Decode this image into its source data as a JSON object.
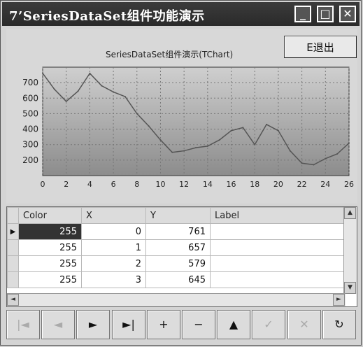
{
  "window": {
    "title": "7’SeriesDataSet组件功能演示",
    "minimize_icon": "minimize-icon",
    "maximize_icon": "maximize-icon",
    "close_icon": "close-icon"
  },
  "exit_button": {
    "label": "E退出"
  },
  "chart_data": {
    "type": "line",
    "title": "SeriesDataSet组件演示(TChart)",
    "x": [
      0,
      1,
      2,
      3,
      4,
      5,
      6,
      7,
      8,
      9,
      10,
      11,
      12,
      13,
      14,
      15,
      16,
      17,
      18,
      19,
      20,
      21,
      22,
      23,
      24,
      25,
      26
    ],
    "values": [
      761,
      657,
      579,
      645,
      760,
      680,
      640,
      610,
      500,
      420,
      330,
      250,
      260,
      280,
      290,
      330,
      390,
      410,
      300,
      430,
      390,
      260,
      180,
      170,
      210,
      240,
      310
    ],
    "x_tick_labels": [
      "0",
      "2",
      "4",
      "6",
      "8",
      "10",
      "12",
      "14",
      "16",
      "18",
      "20",
      "22",
      "24",
      "26"
    ],
    "y_tick_labels": [
      "200",
      "300",
      "400",
      "500",
      "600",
      "700"
    ],
    "ylim": [
      100,
      800
    ],
    "xlim": [
      0,
      26
    ],
    "grid": true,
    "colors": {
      "line": "#555555",
      "bg_top": "#cfcfcf",
      "bg_bottom": "#8c8c8c"
    }
  },
  "grid": {
    "headers": [
      "Color",
      "X",
      "Y",
      "Label"
    ],
    "rows": [
      {
        "color": "255",
        "x": "0",
        "y": "761",
        "label": ""
      },
      {
        "color": "255",
        "x": "1",
        "y": "657",
        "label": ""
      },
      {
        "color": "255",
        "x": "2",
        "y": "579",
        "label": ""
      },
      {
        "color": "255",
        "x": "3",
        "y": "645",
        "label": ""
      }
    ]
  },
  "navigator": {
    "buttons": [
      {
        "icon": "first-icon",
        "glyph": "|◄",
        "enabled": false
      },
      {
        "icon": "prior-icon",
        "glyph": "◄",
        "enabled": false
      },
      {
        "icon": "next-icon",
        "glyph": "►",
        "enabled": true
      },
      {
        "icon": "last-icon",
        "glyph": "►|",
        "enabled": true
      },
      {
        "icon": "insert-icon",
        "glyph": "+",
        "enabled": true
      },
      {
        "icon": "delete-icon",
        "glyph": "−",
        "enabled": true
      },
      {
        "icon": "edit-icon",
        "glyph": "▲",
        "enabled": true
      },
      {
        "icon": "post-icon",
        "glyph": "✓",
        "enabled": false
      },
      {
        "icon": "cancel-icon",
        "glyph": "✕",
        "enabled": false
      },
      {
        "icon": "refresh-icon",
        "glyph": "↻",
        "enabled": true
      }
    ]
  }
}
